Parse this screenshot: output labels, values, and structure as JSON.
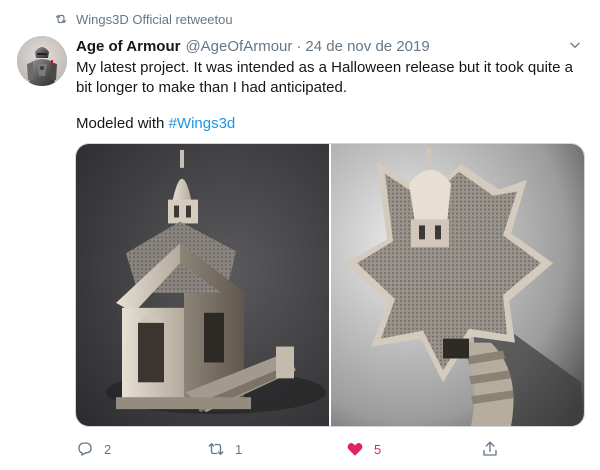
{
  "retweet_context": {
    "text": "Wings3D Official retweetou",
    "icon": "retweet-icon"
  },
  "author": {
    "name": "Age of Armour",
    "handle": "@AgeOfArmour",
    "separator": "·",
    "date": "24 de nov de 2019",
    "avatar_icon": "knight-armour-avatar"
  },
  "body": {
    "line1": "My latest project. It was intended as a Halloween release but it took quite a",
    "line2": "bit longer to make than I had anticipated.",
    "modeled_prefix": "Modeled with ",
    "hashtag": "#Wings3d"
  },
  "media": {
    "images": [
      {
        "name": "mausoleum-render-side-view"
      },
      {
        "name": "mausoleum-render-top-view"
      }
    ]
  },
  "actions": {
    "reply": {
      "icon": "reply-icon",
      "count": "2"
    },
    "retweet": {
      "icon": "retweet-icon",
      "count": "1"
    },
    "like": {
      "icon": "heart-icon",
      "count": "5",
      "active_color": "#e0245e"
    },
    "share": {
      "icon": "share-icon"
    }
  },
  "colors": {
    "text_primary": "#14171a",
    "text_secondary": "#657786",
    "link": "#1b95e0",
    "like": "#e0245e"
  }
}
